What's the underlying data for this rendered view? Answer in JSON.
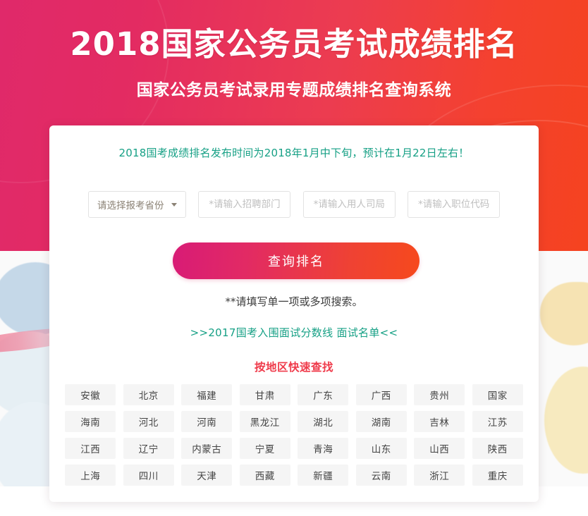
{
  "banner": {
    "title": "2018国家公务员考试成绩排名",
    "subtitle": "国家公务员考试录用专题成绩排名查询系统",
    "gradient_from": "#e0296a",
    "gradient_to": "#f5431f"
  },
  "card": {
    "notice": "2018国考成绩排名发布时间为2018年1月中下旬，预计在1月22日左右！",
    "notice_color": "#16a085",
    "hint": "**请填写单一项或多项搜索。",
    "interview_link": ">>2017国考入围面试分数线 面试名单<<",
    "interview_link_color": "#16a085",
    "region_heading": "按地区快速查找",
    "region_heading_color": "#ef3a4a"
  },
  "form": {
    "province_select": {
      "selected": "请选择报考省份",
      "caret_icon": "chevron-down-icon"
    },
    "department_input": {
      "value": "",
      "placeholder": "*请输入招聘部门"
    },
    "bureau_input": {
      "value": "",
      "placeholder": "*请输入用人司局"
    },
    "position_code_input": {
      "value": "",
      "placeholder": "*请输入职位代码"
    },
    "search_button": "查询排名",
    "search_button_gradient_from": "#d81b76",
    "search_button_gradient_to": "#f6491d"
  },
  "regions": [
    "安徽",
    "北京",
    "福建",
    "甘肃",
    "广东",
    "广西",
    "贵州",
    "国家",
    "海南",
    "河北",
    "河南",
    "黑龙江",
    "湖北",
    "湖南",
    "吉林",
    "江苏",
    "江西",
    "辽宁",
    "内蒙古",
    "宁夏",
    "青海",
    "山东",
    "山西",
    "陕西",
    "上海",
    "四川",
    "天津",
    "西藏",
    "新疆",
    "云南",
    "浙江",
    "重庆"
  ]
}
